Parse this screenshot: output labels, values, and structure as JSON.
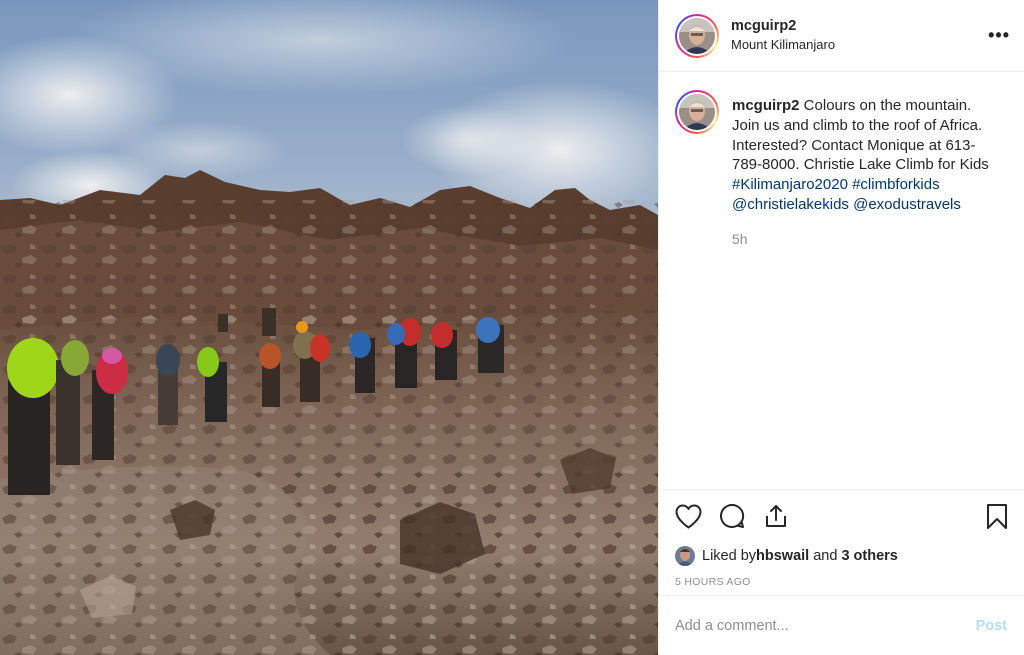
{
  "post": {
    "username": "mcguirp2",
    "location": "Mount Kilimanjaro",
    "more_icon": "•••",
    "caption": {
      "username": "mcguirp2",
      "text": " Colours on the mountain. Join us and climb to the roof of Africa. Interested? Contact Monique at 613-789-8000. Christie Lake Climb for Kids ",
      "tags": [
        "#Kilimanjaro2020",
        "#climbforkids",
        "@christielakekids",
        "@exodustravels"
      ],
      "age": "5h"
    },
    "actions": {
      "like_icon": "heart-icon",
      "comment_icon": "comment-icon",
      "share_icon": "share-icon",
      "save_icon": "bookmark-icon"
    },
    "likes": {
      "prefix": "Liked by ",
      "user": "hbswail",
      "middle": " and ",
      "others": "3 others"
    },
    "timestamp": "5 HOURS AGO",
    "comment_box": {
      "placeholder": "Add a comment...",
      "post_label": "Post"
    }
  },
  "colors": {
    "link": "#00376b",
    "muted": "#8e8e8e",
    "post_button_disabled": "#b2dffc",
    "border": "#efefef"
  }
}
